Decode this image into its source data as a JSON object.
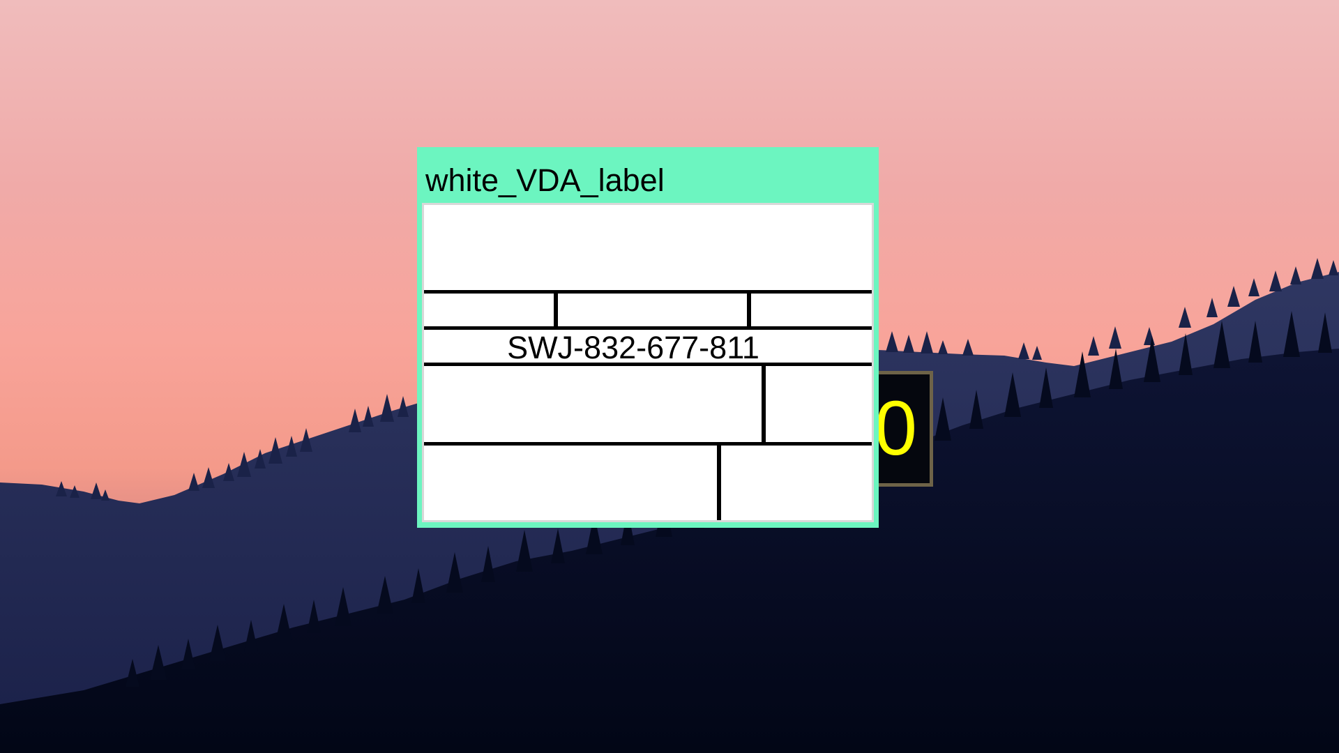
{
  "window": {
    "title": "white_VDA_label"
  },
  "label": {
    "code": "SWJ-832-677-811"
  },
  "counter": {
    "value": "0"
  },
  "colors": {
    "title_bar": "#6cf5c0",
    "counter_text": "#ffff00",
    "counter_bg": "#05070e",
    "counter_border": "#6e6348"
  }
}
